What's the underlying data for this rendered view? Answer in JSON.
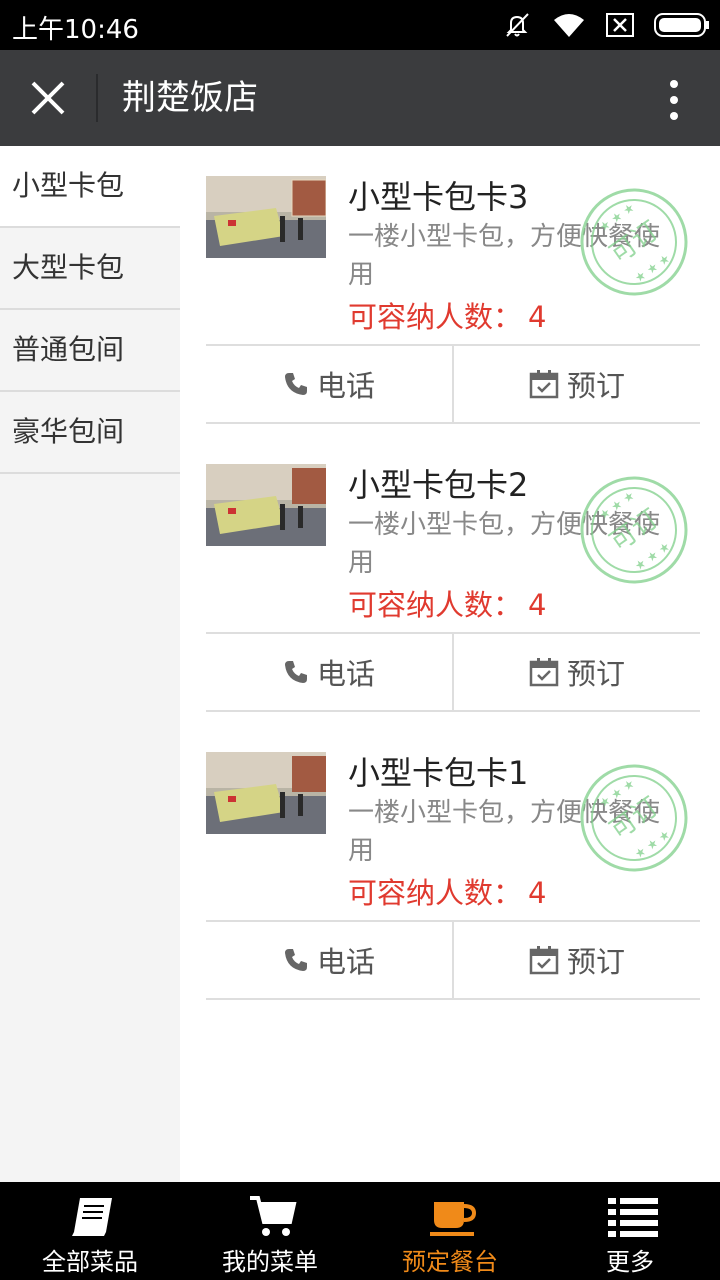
{
  "status_bar": {
    "time": "上午10:46"
  },
  "header": {
    "title": "荆楚饭店"
  },
  "sidebar": {
    "items": [
      {
        "label": "小型卡包",
        "active": true
      },
      {
        "label": "大型卡包",
        "active": false
      },
      {
        "label": "普通包间",
        "active": false
      },
      {
        "label": "豪华包间",
        "active": false
      }
    ]
  },
  "rooms": [
    {
      "name": "小型卡包卡3",
      "desc": "一楼小型卡包，方便快餐使用",
      "capacity_label": "可容纳人数：",
      "capacity": "4",
      "stamp_text": "可订",
      "call_label": "电话",
      "book_label": "预订"
    },
    {
      "name": "小型卡包卡2",
      "desc": "一楼小型卡包，方便快餐使用",
      "capacity_label": "可容纳人数：",
      "capacity": "4",
      "stamp_text": "可订",
      "call_label": "电话",
      "book_label": "预订"
    },
    {
      "name": "小型卡包卡1",
      "desc": "一楼小型卡包，方便快餐使用",
      "capacity_label": "可容纳人数：",
      "capacity": "4",
      "stamp_text": "可订",
      "call_label": "电话",
      "book_label": "预订"
    }
  ],
  "bottom_nav": {
    "tabs": [
      {
        "label": "全部菜品",
        "icon": "book-icon",
        "active": false
      },
      {
        "label": "我的菜单",
        "icon": "cart-icon",
        "active": false
      },
      {
        "label": "预定餐台",
        "icon": "cup-icon",
        "active": true
      },
      {
        "label": "更多",
        "icon": "list-icon",
        "active": false
      }
    ]
  },
  "colors": {
    "accent": "#f08a19",
    "capacity": "#e03a2f",
    "stamp": "#7fcf8a",
    "header_bg": "#3b3c3e"
  }
}
